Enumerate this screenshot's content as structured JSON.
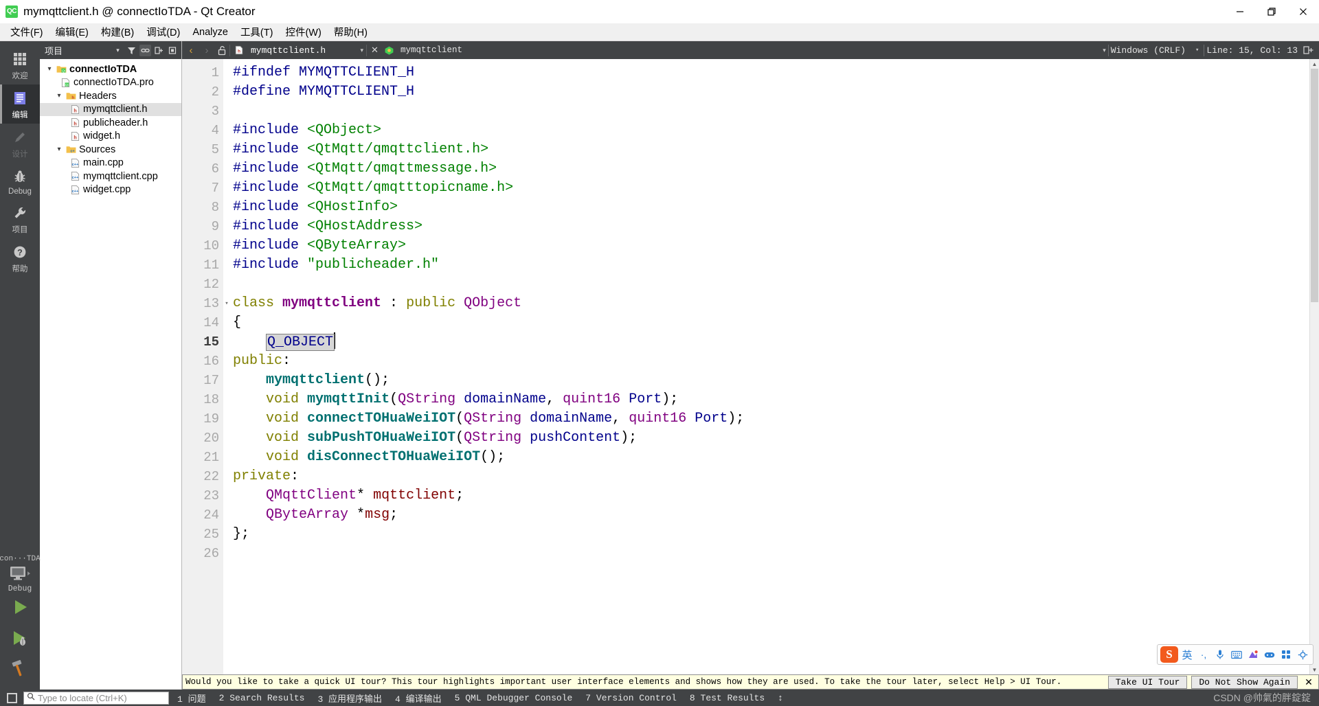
{
  "window": {
    "title": "mymqttclient.h @ connectIoTDA - Qt Creator",
    "app_icon": "QC",
    "minimize": "—",
    "restore": "❐",
    "close": "✕"
  },
  "menubar": [
    {
      "label": "文件(F)",
      "mnemonic": "F"
    },
    {
      "label": "编辑(E)",
      "mnemonic": "E"
    },
    {
      "label": "构建(B)",
      "mnemonic": "B"
    },
    {
      "label": "调试(D)",
      "mnemonic": "D"
    },
    {
      "label": "Analyze",
      "mnemonic": "A"
    },
    {
      "label": "工具(T)",
      "mnemonic": "T"
    },
    {
      "label": "控件(W)",
      "mnemonic": "W"
    },
    {
      "label": "帮助(H)",
      "mnemonic": "H"
    }
  ],
  "modebar": {
    "items": [
      {
        "label": "欢迎",
        "icon": "grid-icon",
        "state": "normal"
      },
      {
        "label": "编辑",
        "icon": "document-icon",
        "state": "active"
      },
      {
        "label": "设计",
        "icon": "pencil-icon",
        "state": "disabled"
      },
      {
        "label": "Debug",
        "icon": "bug-icon",
        "state": "normal"
      },
      {
        "label": "项目",
        "icon": "wrench-icon",
        "state": "normal"
      },
      {
        "label": "帮助",
        "icon": "help-icon",
        "state": "normal"
      }
    ],
    "kit_selector": "con···TDA",
    "kit_mode": "Debug",
    "run_button": "run-icon",
    "debug_button": "debug-run-icon",
    "build_button": "hammer-icon"
  },
  "project_panel": {
    "title": "项目",
    "toolbar_icons": [
      "filter-icon",
      "link-icon",
      "expand-all-icon",
      "sync-icon"
    ],
    "tree": [
      {
        "label": "connectIoTDA",
        "depth": 0,
        "twisty": "down",
        "icon": "qt-project-icon",
        "bold": true,
        "selected": false
      },
      {
        "label": "connectIoTDA.pro",
        "depth": 1,
        "twisty": "none",
        "icon": "pro-file-icon",
        "bold": false,
        "selected": false
      },
      {
        "label": "Headers",
        "depth": 1,
        "twisty": "down",
        "icon": "folder-h-icon",
        "bold": false,
        "selected": false
      },
      {
        "label": "mymqttclient.h",
        "depth": 2,
        "twisty": "none",
        "icon": "h-file-icon",
        "bold": false,
        "selected": true
      },
      {
        "label": "publicheader.h",
        "depth": 2,
        "twisty": "none",
        "icon": "h-file-icon",
        "bold": false,
        "selected": false
      },
      {
        "label": "widget.h",
        "depth": 2,
        "twisty": "none",
        "icon": "h-file-icon",
        "bold": false,
        "selected": false
      },
      {
        "label": "Sources",
        "depth": 1,
        "twisty": "down",
        "icon": "folder-cpp-icon",
        "bold": false,
        "selected": false
      },
      {
        "label": "main.cpp",
        "depth": 2,
        "twisty": "none",
        "icon": "cpp-file-icon",
        "bold": false,
        "selected": false
      },
      {
        "label": "mymqttclient.cpp",
        "depth": 2,
        "twisty": "none",
        "icon": "cpp-file-icon",
        "bold": false,
        "selected": false
      },
      {
        "label": "widget.cpp",
        "depth": 2,
        "twisty": "none",
        "icon": "cpp-file-icon",
        "bold": false,
        "selected": false
      }
    ]
  },
  "editor_toolbar": {
    "back_arrow": "‹",
    "forward_arrow": "›",
    "lock_icon": "unlock-icon",
    "file_name": "mymqttclient.h",
    "file_dropdown": "▾",
    "file_close": "✕",
    "symbol_name": "mymqttclient",
    "symbol_dropdown": "▾",
    "line_ending": "Windows (CRLF)",
    "line_ending_dropdown": "▾",
    "cursor_position": "Line: 15, Col: 13",
    "split_icon": "split-editor-icon"
  },
  "editor": {
    "current_line": 15,
    "fold_lines": [
      13
    ],
    "lines": [
      {
        "n": 1,
        "tokens": [
          {
            "t": "#ifndef ",
            "c": "k-pre"
          },
          {
            "t": "MYMQTTCLIENT_H",
            "c": "k-pre"
          }
        ]
      },
      {
        "n": 2,
        "tokens": [
          {
            "t": "#define ",
            "c": "k-pre"
          },
          {
            "t": "MYMQTTCLIENT_H",
            "c": "k-pre"
          }
        ]
      },
      {
        "n": 3,
        "tokens": []
      },
      {
        "n": 4,
        "tokens": [
          {
            "t": "#include ",
            "c": "k-pre"
          },
          {
            "t": "<QObject>",
            "c": "k-inc"
          }
        ]
      },
      {
        "n": 5,
        "tokens": [
          {
            "t": "#include ",
            "c": "k-pre"
          },
          {
            "t": "<QtMqtt/qmqttclient.h>",
            "c": "k-inc"
          }
        ]
      },
      {
        "n": 6,
        "tokens": [
          {
            "t": "#include ",
            "c": "k-pre"
          },
          {
            "t": "<QtMqtt/qmqttmessage.h>",
            "c": "k-inc"
          }
        ]
      },
      {
        "n": 7,
        "tokens": [
          {
            "t": "#include ",
            "c": "k-pre"
          },
          {
            "t": "<QtMqtt/qmqtttopicname.h>",
            "c": "k-inc"
          }
        ]
      },
      {
        "n": 8,
        "tokens": [
          {
            "t": "#include ",
            "c": "k-pre"
          },
          {
            "t": "<QHostInfo>",
            "c": "k-inc"
          }
        ]
      },
      {
        "n": 9,
        "tokens": [
          {
            "t": "#include ",
            "c": "k-pre"
          },
          {
            "t": "<QHostAddress>",
            "c": "k-inc"
          }
        ]
      },
      {
        "n": 10,
        "tokens": [
          {
            "t": "#include ",
            "c": "k-pre"
          },
          {
            "t": "<QByteArray>",
            "c": "k-inc"
          }
        ]
      },
      {
        "n": 11,
        "tokens": [
          {
            "t": "#include ",
            "c": "k-pre"
          },
          {
            "t": "\"publicheader.h\"",
            "c": "k-str"
          }
        ]
      },
      {
        "n": 12,
        "tokens": []
      },
      {
        "n": 13,
        "tokens": [
          {
            "t": "class ",
            "c": "k-kw"
          },
          {
            "t": "mymqttclient",
            "c": "k-cls"
          },
          {
            "t": " : ",
            "c": "k-pln"
          },
          {
            "t": "public",
            "c": "k-kw"
          },
          {
            "t": " ",
            "c": "k-pln"
          },
          {
            "t": "QObject",
            "c": "k-typ"
          }
        ]
      },
      {
        "n": 14,
        "tokens": [
          {
            "t": "{",
            "c": "k-pln"
          }
        ]
      },
      {
        "n": 15,
        "tokens": [
          {
            "t": "    ",
            "c": "k-pln"
          },
          {
            "t": "Q_OBJECT",
            "c": "macro-box"
          }
        ],
        "caret": true
      },
      {
        "n": 16,
        "tokens": [
          {
            "t": "public",
            "c": "k-kw"
          },
          {
            "t": ":",
            "c": "k-pln"
          }
        ]
      },
      {
        "n": 17,
        "tokens": [
          {
            "t": "    ",
            "c": "k-pln"
          },
          {
            "t": "mymqttclient",
            "c": "k-fn"
          },
          {
            "t": "();",
            "c": "k-pln"
          }
        ]
      },
      {
        "n": 18,
        "tokens": [
          {
            "t": "    ",
            "c": "k-pln"
          },
          {
            "t": "void",
            "c": "k-kw"
          },
          {
            "t": " ",
            "c": "k-pln"
          },
          {
            "t": "mymqttInit",
            "c": "k-fn"
          },
          {
            "t": "(",
            "c": "k-pln"
          },
          {
            "t": "QString",
            "c": "k-typ"
          },
          {
            "t": " ",
            "c": "k-pln"
          },
          {
            "t": "domainName",
            "c": "k-var"
          },
          {
            "t": ", ",
            "c": "k-pln"
          },
          {
            "t": "quint16",
            "c": "k-typ"
          },
          {
            "t": " ",
            "c": "k-pln"
          },
          {
            "t": "Port",
            "c": "k-var"
          },
          {
            "t": ");",
            "c": "k-pln"
          }
        ]
      },
      {
        "n": 19,
        "tokens": [
          {
            "t": "    ",
            "c": "k-pln"
          },
          {
            "t": "void",
            "c": "k-kw"
          },
          {
            "t": " ",
            "c": "k-pln"
          },
          {
            "t": "connectTOHuaWeiIOT",
            "c": "k-fn"
          },
          {
            "t": "(",
            "c": "k-pln"
          },
          {
            "t": "QString",
            "c": "k-typ"
          },
          {
            "t": " ",
            "c": "k-pln"
          },
          {
            "t": "domainName",
            "c": "k-var"
          },
          {
            "t": ", ",
            "c": "k-pln"
          },
          {
            "t": "quint16",
            "c": "k-typ"
          },
          {
            "t": " ",
            "c": "k-pln"
          },
          {
            "t": "Port",
            "c": "k-var"
          },
          {
            "t": ");",
            "c": "k-pln"
          }
        ]
      },
      {
        "n": 20,
        "tokens": [
          {
            "t": "    ",
            "c": "k-pln"
          },
          {
            "t": "void",
            "c": "k-kw"
          },
          {
            "t": " ",
            "c": "k-pln"
          },
          {
            "t": "subPushTOHuaWeiIOT",
            "c": "k-fn"
          },
          {
            "t": "(",
            "c": "k-pln"
          },
          {
            "t": "QString",
            "c": "k-typ"
          },
          {
            "t": " ",
            "c": "k-pln"
          },
          {
            "t": "pushContent",
            "c": "k-var"
          },
          {
            "t": ");",
            "c": "k-pln"
          }
        ]
      },
      {
        "n": 21,
        "tokens": [
          {
            "t": "    ",
            "c": "k-pln"
          },
          {
            "t": "void",
            "c": "k-kw"
          },
          {
            "t": " ",
            "c": "k-pln"
          },
          {
            "t": "disConnectTOHuaWeiIOT",
            "c": "k-fn"
          },
          {
            "t": "();",
            "c": "k-pln"
          }
        ]
      },
      {
        "n": 22,
        "tokens": [
          {
            "t": "private",
            "c": "k-kw"
          },
          {
            "t": ":",
            "c": "k-pln"
          }
        ]
      },
      {
        "n": 23,
        "tokens": [
          {
            "t": "    ",
            "c": "k-pln"
          },
          {
            "t": "QMqttClient",
            "c": "k-typ"
          },
          {
            "t": "* ",
            "c": "k-pln"
          },
          {
            "t": "mqttclient",
            "c": "k-mem"
          },
          {
            "t": ";",
            "c": "k-pln"
          }
        ]
      },
      {
        "n": 24,
        "tokens": [
          {
            "t": "    ",
            "c": "k-pln"
          },
          {
            "t": "QByteArray",
            "c": "k-typ"
          },
          {
            "t": " *",
            "c": "k-pln"
          },
          {
            "t": "msg",
            "c": "k-mem"
          },
          {
            "t": ";",
            "c": "k-pln"
          }
        ]
      },
      {
        "n": 25,
        "tokens": [
          {
            "t": "};",
            "c": "k-pln"
          }
        ]
      },
      {
        "n": 26,
        "tokens": []
      }
    ]
  },
  "tour_banner": {
    "message": "Would you like to take a quick UI tour? This tour highlights important user interface elements and shows how they are used. To take the tour later, select Help > UI Tour.",
    "take_tour": "Take UI Tour",
    "dont_show": "Do Not Show Again",
    "close": "✕"
  },
  "statusbar": {
    "locator_placeholder": "Type to locate (Ctrl+K)",
    "panels": [
      "1 问题",
      "2 Search Results",
      "3 应用程序输出",
      "4 编译输出",
      "5 QML Debugger Console",
      "7 Version Control",
      "8 Test Results"
    ],
    "updown": "↕",
    "watermark": "CSDN @帅氣的胖錠錠"
  },
  "ime": {
    "logo": "S",
    "items": [
      {
        "label": "英",
        "icon": "language-icon"
      },
      {
        "label": "·,",
        "icon": "punctuation-icon"
      },
      {
        "label": "🎤",
        "icon": "microphone-icon"
      },
      {
        "label": "⌨",
        "icon": "keyboard-icon"
      },
      {
        "label": "✦",
        "icon": "skin-icon"
      },
      {
        "label": "◉",
        "icon": "game-icon"
      },
      {
        "label": "▦",
        "icon": "tools-icon"
      },
      {
        "label": "✽",
        "icon": "settings-icon"
      }
    ]
  },
  "colors": {
    "dark_chrome": "#414345",
    "accent_green": "#41cd52",
    "selection_gray": "#e0e0e0",
    "banner_yellow": "#ffffe1"
  }
}
